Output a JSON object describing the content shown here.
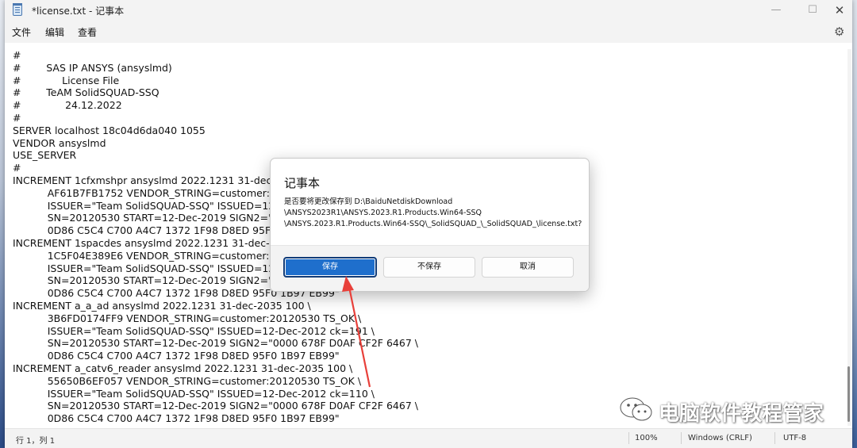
{
  "window": {
    "title": "*license.txt - 记事本",
    "min_glyph": "—",
    "max_glyph": "☐",
    "close_glyph": "✕"
  },
  "menu": [
    "文件",
    "编辑",
    "查看"
  ],
  "settings_icon": "⚙",
  "editor_lines": [
    "#",
    "#        SAS IP ANSYS (ansyslmd)",
    "#             License File",
    "#        TeAM SolidSQUAD-SSQ",
    "#              24.12.2022",
    "#",
    "SERVER localhost 18c04d6da040 1055",
    "VENDOR ansyslmd",
    "USE_SERVER",
    "#",
    "INCREMENT 1cfxmshpr ansyslmd 2022.1231 31-dec-2035",
    "           AF61B7FB1752 VENDOR_STRING=customer:2012053",
    "           ISSUER=\"Team SolidSQUAD-SSQ\" ISSUED=12-Dec",
    "           SN=20120530 START=12-Dec-2019 SIGN2=\"0000",
    "           0D86 C5C4 C700 A4C7 1372 1F98 D8ED 95F0 1B97",
    "INCREMENT 1spacdes ansyslmd 2022.1231 31-dec-2035",
    "           1C5F04E389E6 VENDOR_STRING=customer:20120",
    "           ISSUER=\"Team SolidSQUAD-SSQ\" ISSUED=12-Dec",
    "           SN=20120530 START=12-Dec-2019 SIGN2=\"0000",
    "           0D86 C5C4 C700 A4C7 1372 1F98 D8ED 95F0 1B97 EB99\"",
    "INCREMENT a_a_ad ansyslmd 2022.1231 31-dec-2035 100 \\",
    "           3B6FD0174FF9 VENDOR_STRING=customer:20120530 TS_OK \\",
    "           ISSUER=\"Team SolidSQUAD-SSQ\" ISSUED=12-Dec-2012 ck=191 \\",
    "           SN=20120530 START=12-Dec-2019 SIGN2=\"0000 678F D0AF CF2F 6467 \\",
    "           0D86 C5C4 C700 A4C7 1372 1F98 D8ED 95F0 1B97 EB99\"",
    "INCREMENT a_catv6_reader ansyslmd 2022.1231 31-dec-2035 100 \\",
    "           55650B6EF057 VENDOR_STRING=customer:20120530 TS_OK \\",
    "           ISSUER=\"Team SolidSQUAD-SSQ\" ISSUED=12-Dec-2012 ck=110 \\",
    "           SN=20120530 START=12-Dec-2019 SIGN2=\"0000 678F D0AF CF2F 6467 \\",
    "           0D86 C5C4 C700 A4C7 1372 1F98 D8ED 95F0 1B97 EB99\""
  ],
  "status": {
    "position": "行 1，列 1",
    "zoom": "100%",
    "line_ending": "Windows (CRLF)",
    "encoding": "UTF-8"
  },
  "dialog": {
    "title": "记事本",
    "message_lines": [
      "是否要将更改保存到 D:\\BaiduNetdiskDownload",
      "\\ANSYS2023R1\\ANSYS.2023.R1.Products.Win64-SSQ",
      "\\ANSYS.2023.R1.Products.Win64-SSQ\\_SolidSQUAD_\\_SolidSQUAD_\\license.txt?"
    ],
    "save_label": "保存",
    "dont_save_label": "不保存",
    "cancel_label": "取消"
  },
  "watermark": {
    "text": "电脑软件教程管家"
  },
  "colors": {
    "primary_button": "#1f6fcc",
    "arrow": "#e8403a"
  }
}
